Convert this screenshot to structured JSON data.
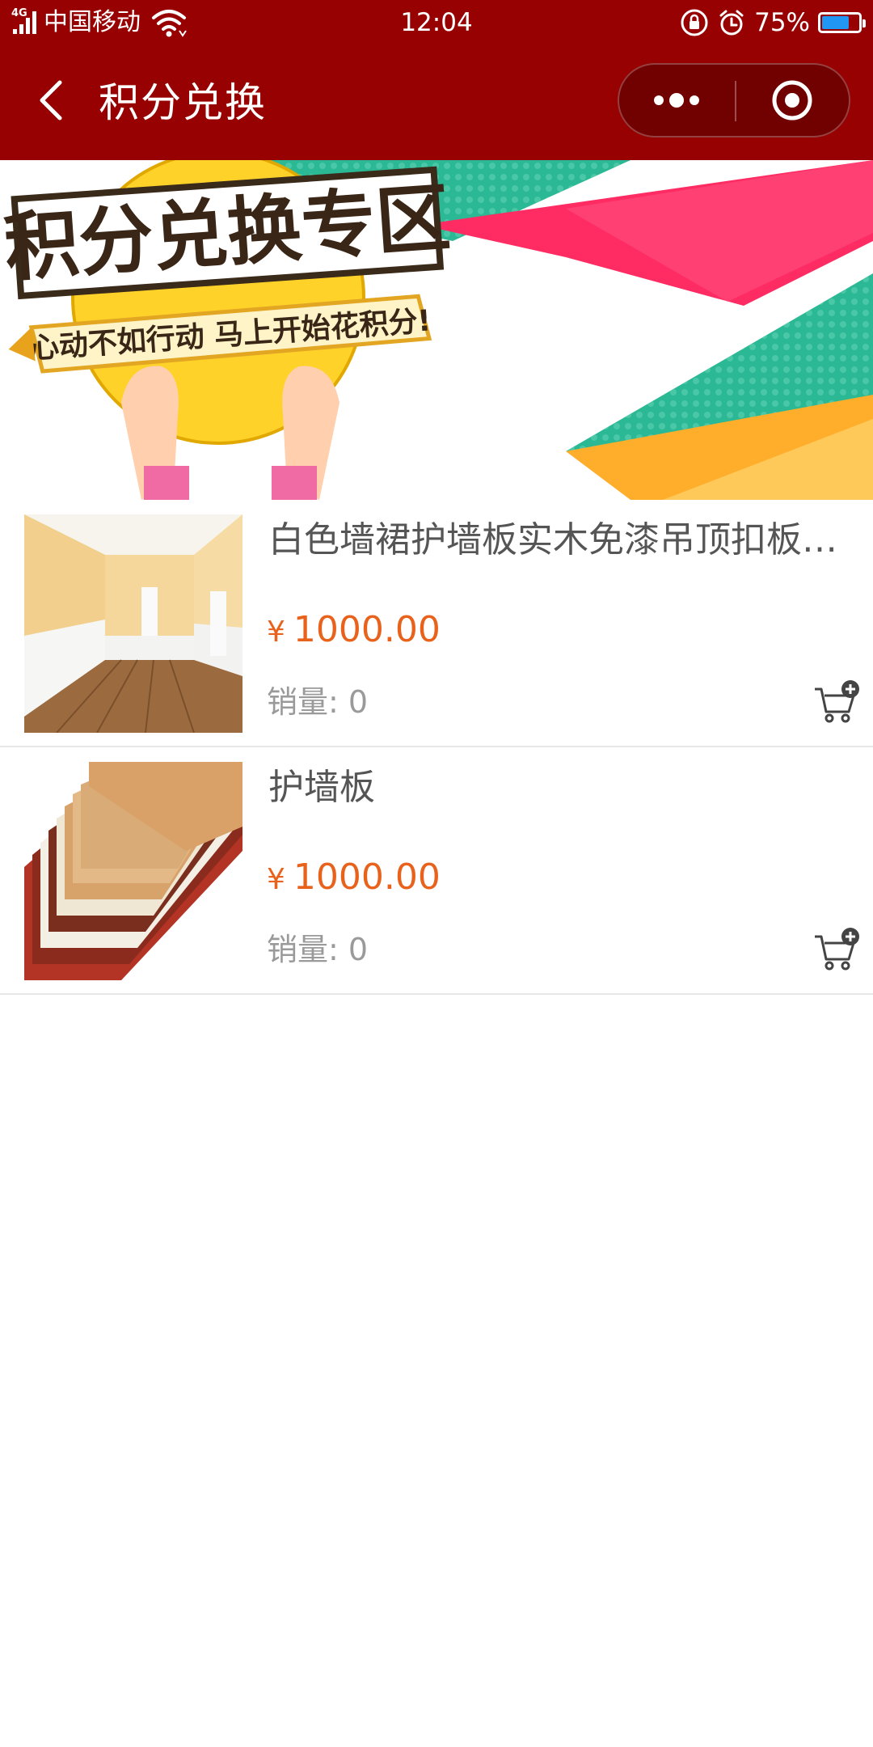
{
  "status_bar": {
    "network": "4G",
    "carrier": "中国移动",
    "time": "12:04",
    "battery": "75%",
    "battery_level": 0.75,
    "icons": [
      "signal-icon",
      "wifi-icon",
      "rotation-lock-icon",
      "alarm-icon",
      "battery-icon"
    ]
  },
  "nav": {
    "title": "积分兑换",
    "back_icon": "chevron-left-icon",
    "more_icon": "more-dots-icon",
    "close_icon": "capsule-close-icon",
    "bg_color": "#980101"
  },
  "banner": {
    "headline": "积分兑换专区",
    "tagline": "心动不如行动 马上开始花积分!"
  },
  "products": [
    {
      "name": "白色墙裙护墙板实木免漆吊顶扣板…",
      "currency": "¥",
      "price": "1000.00",
      "sales_label": "销量:",
      "sales_value": "0"
    },
    {
      "name": "护墙板",
      "currency": "¥",
      "price": "1000.00",
      "sales_label": "销量:",
      "sales_value": "0"
    }
  ],
  "colors": {
    "accent": "#e8621c",
    "brand": "#980101"
  }
}
